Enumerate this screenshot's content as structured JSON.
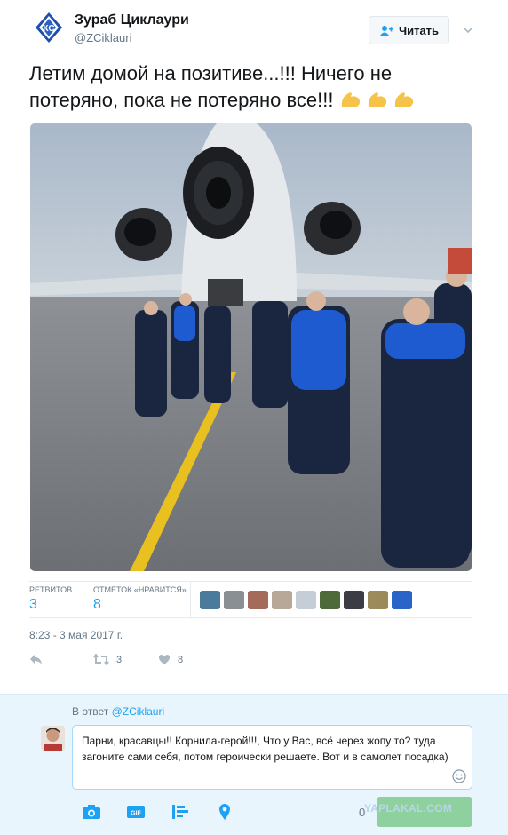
{
  "author": {
    "name": "Зураб Циклаури",
    "handle": "@ZCiklauri",
    "avatar_icon": "krylia-sovetov-logo-icon"
  },
  "follow_button": {
    "label": "Читать",
    "icon": "add-user-icon"
  },
  "tweet": {
    "text": "Летим домой на позитиве...!!! Ничего не потеряно, пока не потеряно все!!!",
    "emoji": [
      "flexed-biceps-emoji",
      "flexed-biceps-emoji",
      "flexed-biceps-emoji"
    ]
  },
  "stats": {
    "retweets_label": "РЕТВИТОВ",
    "retweets_value": "3",
    "likes_label": "ОТМЕТОК «НРАВИТСЯ»",
    "likes_value": "8"
  },
  "timestamp": "8:23 - 3 мая 2017 г.",
  "actions": {
    "reply_icon": "reply-icon",
    "retweet_icon": "retweet-icon",
    "retweet_count": "3",
    "like_icon": "heart-icon",
    "like_count": "8"
  },
  "reply": {
    "prefix": "В ответ ",
    "mention": "@ZCiklauri",
    "text": "Парни, красавцы!! Корнила-герой!!!, Что у Вас, всё через жопу то? туда загоните сами себя, потом героически решаете. Вот и в самолет посадка)",
    "char_count": "0",
    "tools": [
      "camera-icon",
      "gif-icon",
      "poll-icon",
      "location-icon"
    ]
  },
  "watermark": "YAPLAKAL.COM",
  "colors": {
    "accent": "#1da1f2",
    "reply_bg": "#e8f5fd",
    "reply_button": "#8fd19e"
  }
}
